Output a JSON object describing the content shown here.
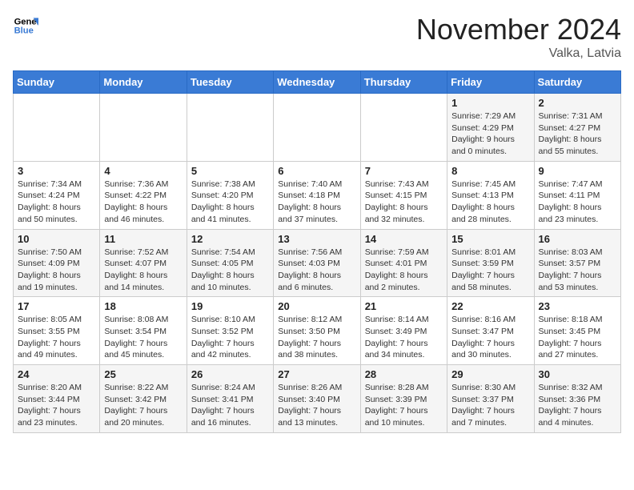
{
  "header": {
    "logo_line1": "General",
    "logo_line2": "Blue",
    "month_title": "November 2024",
    "location": "Valka, Latvia"
  },
  "weekdays": [
    "Sunday",
    "Monday",
    "Tuesday",
    "Wednesday",
    "Thursday",
    "Friday",
    "Saturday"
  ],
  "weeks": [
    [
      {
        "day": "",
        "info": ""
      },
      {
        "day": "",
        "info": ""
      },
      {
        "day": "",
        "info": ""
      },
      {
        "day": "",
        "info": ""
      },
      {
        "day": "",
        "info": ""
      },
      {
        "day": "1",
        "info": "Sunrise: 7:29 AM\nSunset: 4:29 PM\nDaylight: 9 hours\nand 0 minutes."
      },
      {
        "day": "2",
        "info": "Sunrise: 7:31 AM\nSunset: 4:27 PM\nDaylight: 8 hours\nand 55 minutes."
      }
    ],
    [
      {
        "day": "3",
        "info": "Sunrise: 7:34 AM\nSunset: 4:24 PM\nDaylight: 8 hours\nand 50 minutes."
      },
      {
        "day": "4",
        "info": "Sunrise: 7:36 AM\nSunset: 4:22 PM\nDaylight: 8 hours\nand 46 minutes."
      },
      {
        "day": "5",
        "info": "Sunrise: 7:38 AM\nSunset: 4:20 PM\nDaylight: 8 hours\nand 41 minutes."
      },
      {
        "day": "6",
        "info": "Sunrise: 7:40 AM\nSunset: 4:18 PM\nDaylight: 8 hours\nand 37 minutes."
      },
      {
        "day": "7",
        "info": "Sunrise: 7:43 AM\nSunset: 4:15 PM\nDaylight: 8 hours\nand 32 minutes."
      },
      {
        "day": "8",
        "info": "Sunrise: 7:45 AM\nSunset: 4:13 PM\nDaylight: 8 hours\nand 28 minutes."
      },
      {
        "day": "9",
        "info": "Sunrise: 7:47 AM\nSunset: 4:11 PM\nDaylight: 8 hours\nand 23 minutes."
      }
    ],
    [
      {
        "day": "10",
        "info": "Sunrise: 7:50 AM\nSunset: 4:09 PM\nDaylight: 8 hours\nand 19 minutes."
      },
      {
        "day": "11",
        "info": "Sunrise: 7:52 AM\nSunset: 4:07 PM\nDaylight: 8 hours\nand 14 minutes."
      },
      {
        "day": "12",
        "info": "Sunrise: 7:54 AM\nSunset: 4:05 PM\nDaylight: 8 hours\nand 10 minutes."
      },
      {
        "day": "13",
        "info": "Sunrise: 7:56 AM\nSunset: 4:03 PM\nDaylight: 8 hours\nand 6 minutes."
      },
      {
        "day": "14",
        "info": "Sunrise: 7:59 AM\nSunset: 4:01 PM\nDaylight: 8 hours\nand 2 minutes."
      },
      {
        "day": "15",
        "info": "Sunrise: 8:01 AM\nSunset: 3:59 PM\nDaylight: 7 hours\nand 58 minutes."
      },
      {
        "day": "16",
        "info": "Sunrise: 8:03 AM\nSunset: 3:57 PM\nDaylight: 7 hours\nand 53 minutes."
      }
    ],
    [
      {
        "day": "17",
        "info": "Sunrise: 8:05 AM\nSunset: 3:55 PM\nDaylight: 7 hours\nand 49 minutes."
      },
      {
        "day": "18",
        "info": "Sunrise: 8:08 AM\nSunset: 3:54 PM\nDaylight: 7 hours\nand 45 minutes."
      },
      {
        "day": "19",
        "info": "Sunrise: 8:10 AM\nSunset: 3:52 PM\nDaylight: 7 hours\nand 42 minutes."
      },
      {
        "day": "20",
        "info": "Sunrise: 8:12 AM\nSunset: 3:50 PM\nDaylight: 7 hours\nand 38 minutes."
      },
      {
        "day": "21",
        "info": "Sunrise: 8:14 AM\nSunset: 3:49 PM\nDaylight: 7 hours\nand 34 minutes."
      },
      {
        "day": "22",
        "info": "Sunrise: 8:16 AM\nSunset: 3:47 PM\nDaylight: 7 hours\nand 30 minutes."
      },
      {
        "day": "23",
        "info": "Sunrise: 8:18 AM\nSunset: 3:45 PM\nDaylight: 7 hours\nand 27 minutes."
      }
    ],
    [
      {
        "day": "24",
        "info": "Sunrise: 8:20 AM\nSunset: 3:44 PM\nDaylight: 7 hours\nand 23 minutes."
      },
      {
        "day": "25",
        "info": "Sunrise: 8:22 AM\nSunset: 3:42 PM\nDaylight: 7 hours\nand 20 minutes."
      },
      {
        "day": "26",
        "info": "Sunrise: 8:24 AM\nSunset: 3:41 PM\nDaylight: 7 hours\nand 16 minutes."
      },
      {
        "day": "27",
        "info": "Sunrise: 8:26 AM\nSunset: 3:40 PM\nDaylight: 7 hours\nand 13 minutes."
      },
      {
        "day": "28",
        "info": "Sunrise: 8:28 AM\nSunset: 3:39 PM\nDaylight: 7 hours\nand 10 minutes."
      },
      {
        "day": "29",
        "info": "Sunrise: 8:30 AM\nSunset: 3:37 PM\nDaylight: 7 hours\nand 7 minutes."
      },
      {
        "day": "30",
        "info": "Sunrise: 8:32 AM\nSunset: 3:36 PM\nDaylight: 7 hours\nand 4 minutes."
      }
    ]
  ]
}
